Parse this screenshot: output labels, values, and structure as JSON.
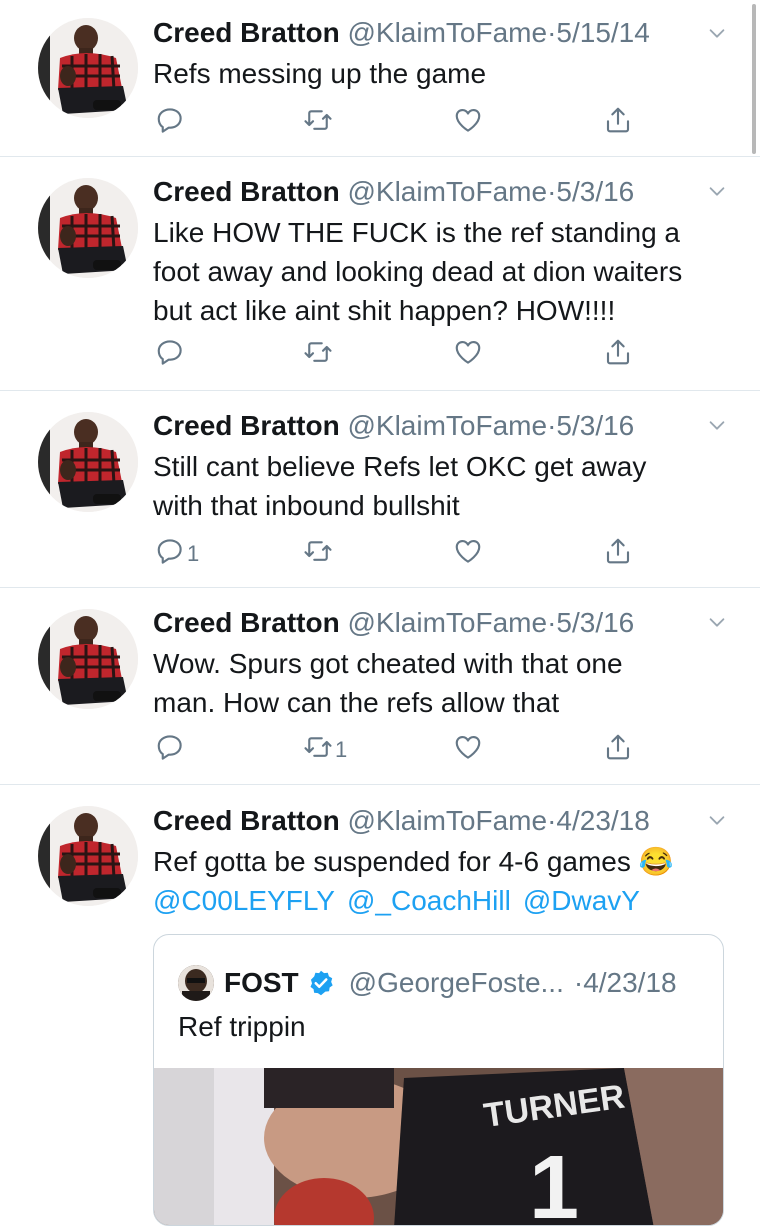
{
  "tweets": [
    {
      "name": "Creed Bratton",
      "handle": "@KlaimToFame",
      "sep": "·",
      "date": "5/15/14",
      "lines": [
        "Refs messing up the game"
      ],
      "reply_count": "",
      "retweet_count": "",
      "like_count": ""
    },
    {
      "name": "Creed Bratton",
      "handle": "@KlaimToFame",
      "sep": "·",
      "date": "5/3/16",
      "lines": [
        "Like HOW THE FUCK is the ref standing a",
        "foot away and looking dead at dion waiters",
        "but act like aint shit happen? HOW!!!!"
      ],
      "reply_count": "",
      "retweet_count": "",
      "like_count": ""
    },
    {
      "name": "Creed Bratton",
      "handle": "@KlaimToFame",
      "sep": "·",
      "date": "5/3/16",
      "lines": [
        "Still cant believe Refs let OKC get away",
        "with that inbound bullshit"
      ],
      "reply_count": "1",
      "retweet_count": "",
      "like_count": ""
    },
    {
      "name": "Creed Bratton",
      "handle": "@KlaimToFame",
      "sep": "·",
      "date": "5/3/16",
      "lines": [
        "Wow. Spurs got cheated with that one",
        "man. How can the refs allow that"
      ],
      "reply_count": "",
      "retweet_count": "1",
      "like_count": ""
    },
    {
      "name": "Creed Bratton",
      "handle": "@KlaimToFame",
      "sep": "·",
      "date": "4/23/18",
      "lines": [
        "Ref gotta be suspended for 4-6 games 😂"
      ],
      "mentions": [
        "@C00LEYFLY",
        "@_CoachHill",
        "@DwavY"
      ],
      "quote": {
        "name": "FOST",
        "handle": "@GeorgeFoste...",
        "sep": "·",
        "date": "4/23/18",
        "text": "Ref trippin",
        "jersey_name": "TURNER",
        "jersey_number": "1"
      }
    }
  ],
  "colors": {
    "text": "#14171a",
    "secondary": "#657786",
    "link": "#1da1f2",
    "divider": "#e1e8ed"
  },
  "icons": [
    "reply-icon",
    "retweet-icon",
    "like-icon",
    "share-icon",
    "chevron-down-icon",
    "verified-badge-icon"
  ]
}
